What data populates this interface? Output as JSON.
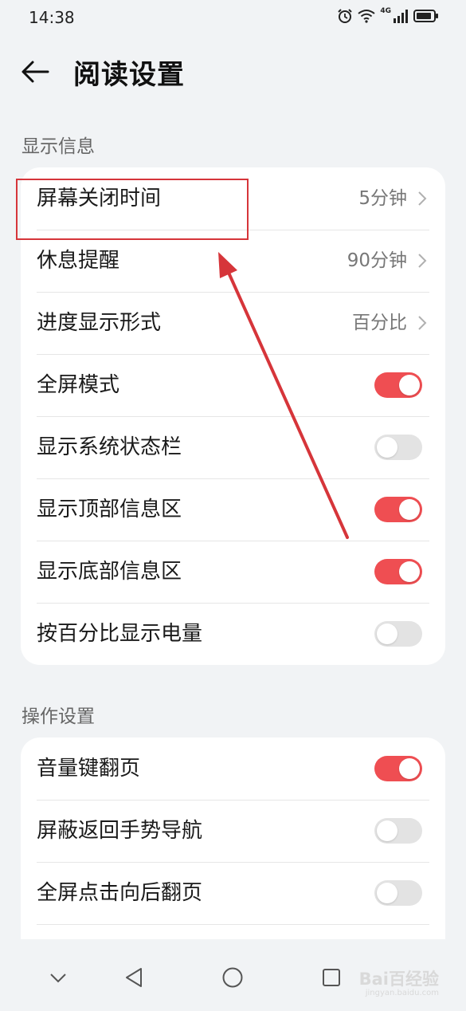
{
  "status_bar": {
    "time": "14:38",
    "icons": [
      "alarm-icon",
      "wifi-icon",
      "signal-icon",
      "battery-icon"
    ],
    "network": "4G"
  },
  "header": {
    "back_icon": "arrow-left-icon",
    "title": "阅读设置"
  },
  "sections": {
    "display": {
      "title": "显示信息",
      "rows": [
        {
          "label": "屏幕关闭时间",
          "value": "5分钟"
        },
        {
          "label": "休息提醒",
          "value": "90分钟"
        },
        {
          "label": "进度显示形式",
          "value": "百分比"
        },
        {
          "label": "全屏模式",
          "toggle": true
        },
        {
          "label": "显示系统状态栏",
          "toggle": false
        },
        {
          "label": "显示顶部信息区",
          "toggle": true
        },
        {
          "label": "显示底部信息区",
          "toggle": true
        },
        {
          "label": "按百分比显示电量",
          "toggle": false
        }
      ]
    },
    "operation": {
      "title": "操作设置",
      "rows": [
        {
          "label": "音量键翻页",
          "toggle": true
        },
        {
          "label": "屏蔽返回手势导航",
          "toggle": false
        },
        {
          "label": "全屏点击向后翻页",
          "toggle": false
        }
      ]
    }
  },
  "nav_bar": {
    "icons": [
      "chevron-down-icon",
      "back-triangle-icon",
      "home-circle-icon",
      "recents-square-icon"
    ]
  },
  "watermark": {
    "text": "Bai百经验",
    "sub": "jingyan.baidu.com"
  },
  "colors": {
    "accent": "#ef4e52",
    "annotation": "#d6353a",
    "background": "#f1f3f5"
  }
}
